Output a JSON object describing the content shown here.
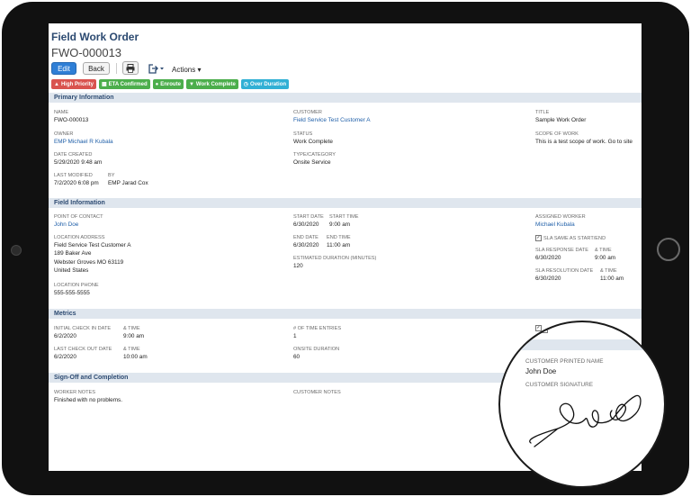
{
  "header": {
    "title": "Field Work Order",
    "record_id": "FWO-000013"
  },
  "toolbar": {
    "edit_label": "Edit",
    "back_label": "Back",
    "actions_label": "Actions"
  },
  "badges": [
    {
      "label": "High Priority",
      "color": "#d9534f",
      "icon": "warning-icon"
    },
    {
      "label": "ETA Confirmed",
      "color": "#4cae4c",
      "icon": "calendar-icon"
    },
    {
      "label": "Enroute",
      "color": "#4cae4c",
      "icon": "map-pin-icon"
    },
    {
      "label": "Work Complete",
      "color": "#4cae4c",
      "icon": "trophy-icon"
    },
    {
      "label": "Over Duration",
      "color": "#31b0d5",
      "icon": "clock-icon"
    }
  ],
  "sections": {
    "primary": "Primary Information",
    "field": "Field Information",
    "metrics": "Metrics",
    "signoff": "Sign-Off and Completion"
  },
  "primary": {
    "name_label": "NAME",
    "name": "FWO-000013",
    "owner_label": "OWNER",
    "owner": "EMP Michael R Kubala",
    "date_created_label": "DATE CREATED",
    "date_created": "5/29/2020 9:48 am",
    "last_modified_label": "LAST MODIFIED",
    "last_modified": "7/2/2020 6:08 pm",
    "by_label": "BY",
    "by": "EMP Jarad Cox",
    "customer_label": "CUSTOMER",
    "customer": "Field Service Test Customer A",
    "status_label": "STATUS",
    "status": "Work Complete",
    "type_label": "TYPE/CATEGORY",
    "type": "Onsite Service",
    "title_label": "TITLE",
    "title": "Sample Work Order",
    "scope_label": "SCOPE OF WORK",
    "scope": "This is a test scope of work. Go to site"
  },
  "field": {
    "poc_label": "POINT OF CONTACT",
    "poc": "John Doe",
    "address_label": "LOCATION ADDRESS",
    "address_lines": [
      "Field Service Test Customer A",
      "189 Baker Ave",
      "Webster Groves MO 63119",
      "United States"
    ],
    "phone_label": "LOCATION PHONE",
    "phone": "555-555-5555",
    "start_date_label": "START DATE",
    "start_date": "6/30/2020",
    "start_time_label": "START TIME",
    "start_time": "9:00 am",
    "end_date_label": "END DATE",
    "end_date": "6/30/2020",
    "end_time_label": "END TIME",
    "end_time": "11:00 am",
    "est_duration_label": "ESTIMATED DURATION (MINUTES)",
    "est_duration": "120",
    "assigned_label": "ASSIGNED WORKER",
    "assigned": "Michael Kubala",
    "sla_same_label": "SLA SAME AS START/END",
    "sla_response_label": "SLA RESPONSE DATE",
    "sla_time_label": "& TIME",
    "sla_response_date": "6/30/2020",
    "sla_response_time": "9:00 am",
    "sla_resolution_label": "SLA RESOLUTION DATE",
    "sla_resolution_date": "6/30/2020",
    "sla_resolution_time": "11:00 am"
  },
  "metrics": {
    "initial_label": "INITIAL CHECK IN DATE",
    "time_label": "& TIME",
    "initial_date": "6/2/2020",
    "initial_time": "9:00 am",
    "last_label": "LAST CHECK OUT DATE",
    "last_date": "6/2/2020",
    "last_time": "10:00 am",
    "entries_label": "# OF TIME ENTRIES",
    "entries": "1",
    "onsite_label": "ONSITE DURATION",
    "onsite": "60"
  },
  "signoff": {
    "worker_notes_label": "WORKER NOTES",
    "worker_notes": "Finished with no problems.",
    "customer_notes_label": "CUSTOMER NOTES"
  },
  "zoom": {
    "printed_name_label": "CUSTOMER PRINTED NAME",
    "printed_name": "John Doe",
    "signature_label": "CUSTOMER SIGNATURE"
  }
}
